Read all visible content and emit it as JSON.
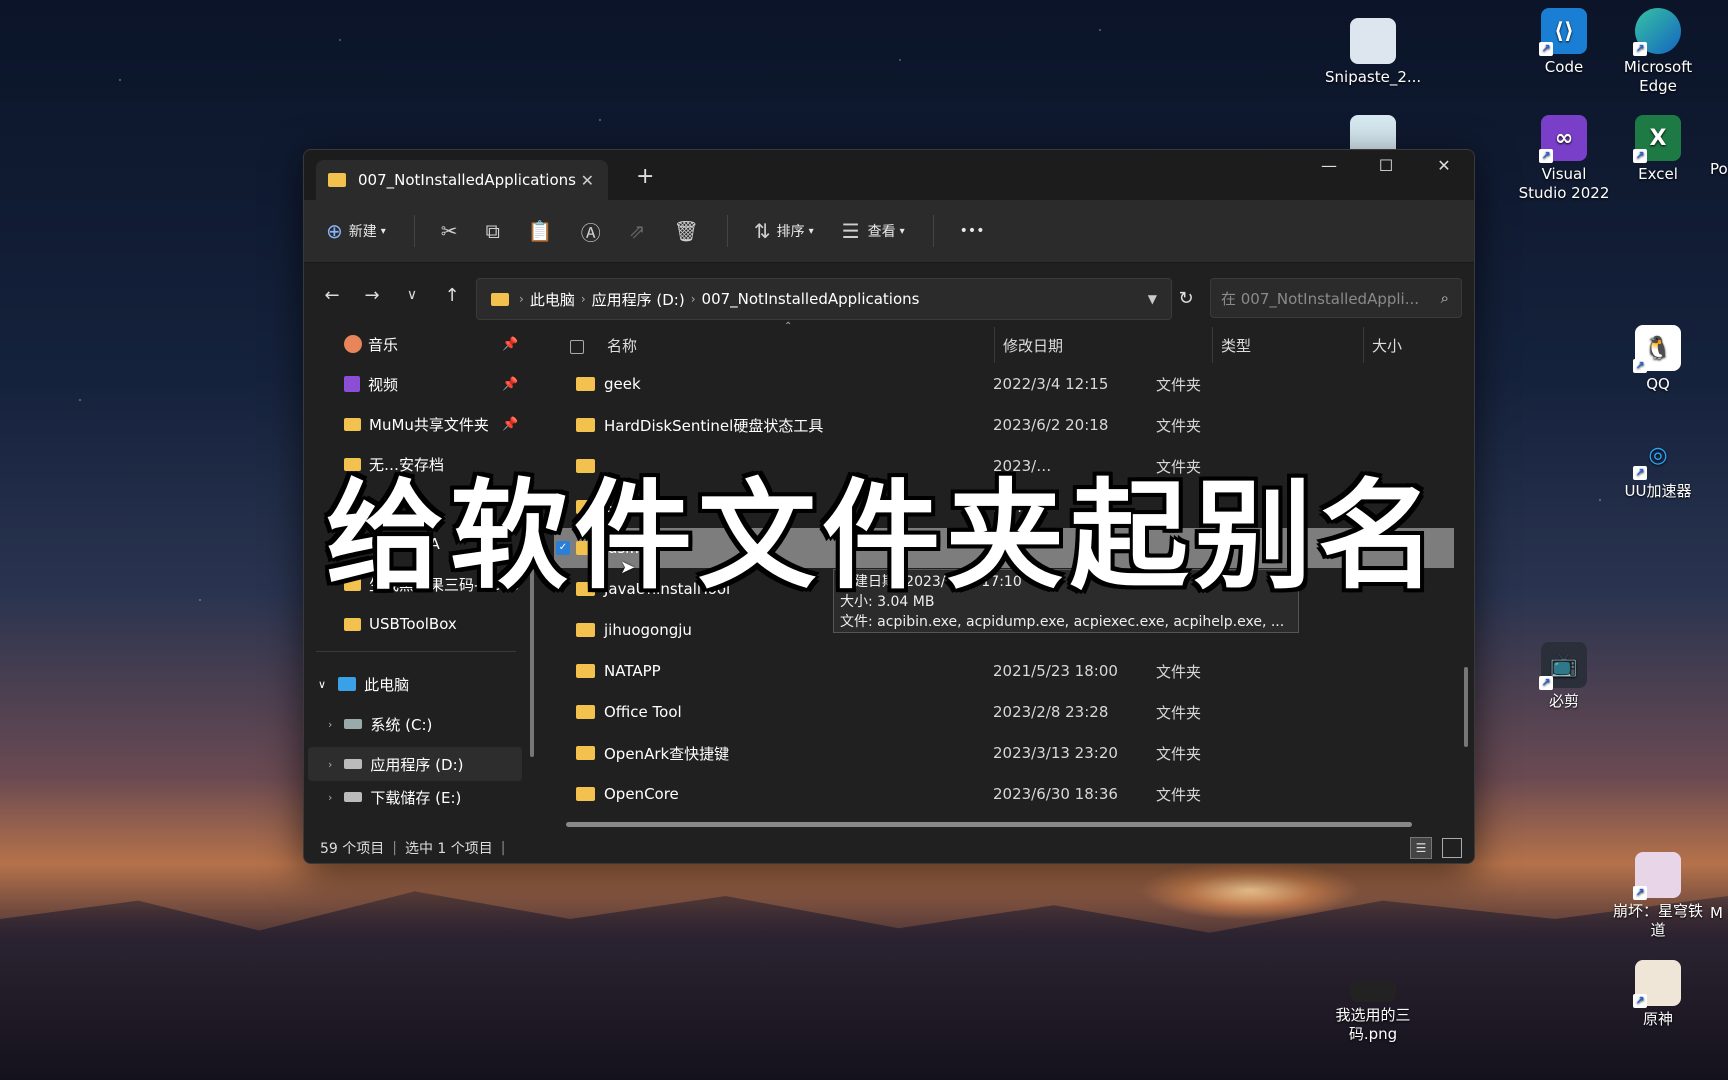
{
  "desktop": {
    "icons": [
      {
        "name": "snipaste-icon",
        "label": "Snipaste_2..."
      },
      {
        "name": "code-icon",
        "label": "Code"
      },
      {
        "name": "edge-icon",
        "label": "Microsoft Edge"
      },
      {
        "name": "vs2022-icon",
        "label": "Visual Studio 2022"
      },
      {
        "name": "excel-icon",
        "label": "Excel"
      },
      {
        "name": "qq-icon",
        "label": "QQ"
      },
      {
        "name": "uu-icon",
        "label": "UU加速器"
      },
      {
        "name": "bijian-icon",
        "label": "必剪"
      },
      {
        "name": "starrail-icon",
        "label": "崩坏：星穹铁道"
      },
      {
        "name": "yuanshen-icon",
        "label": "原神"
      },
      {
        "name": "png-file-icon",
        "label": "我选用的三码.png"
      }
    ],
    "edge_label_right": "Po",
    "edge_label_right2": "M"
  },
  "window": {
    "tab_title": "007_NotInstalledApplications",
    "toolbar": {
      "new_label": "新建",
      "sort_label": "排序",
      "view_label": "查看",
      "more": "•••"
    },
    "breadcrumb": [
      "此电脑",
      "应用程序 (D:)",
      "007_NotInstalledApplications"
    ],
    "search_placeholder": "在 007_NotInstalledAppli...",
    "sidebar": {
      "quick": [
        "音乐",
        "视频",
        "MuMu共享文件夹",
        "无…安存档",
        "…ta",
        "…nstall A",
        "生成黑苹果三码-GenS",
        "USBToolBox"
      ],
      "this_pc": "此电脑",
      "drives": [
        "系统 (C:)",
        "应用程序 (D:)",
        "下载储存 (E:)"
      ]
    },
    "columns": {
      "name": "名称",
      "date": "修改日期",
      "type": "类型",
      "size": "大小"
    },
    "rows": [
      {
        "name": "geek",
        "date": "2022/3/4 12:15",
        "type": "文件夹"
      },
      {
        "name": "HardDiskSentinel硬盘状态工具",
        "date": "2023/6/2 20:18",
        "type": "文件夹"
      },
      {
        "name": "",
        "date": "2023/…",
        "type": "文件夹"
      },
      {
        "name": "Sl…iacha",
        "date": "20…",
        "type": ""
      },
      {
        "name": "iasl…dt",
        "date": "",
        "type": ""
      },
      {
        "name": "JavaUninstallTool",
        "date": "",
        "type": ""
      },
      {
        "name": "jihuogongju",
        "date": "2023/…",
        "type": "文件夹"
      },
      {
        "name": "NATAPP",
        "date": "2021/5/23 18:00",
        "type": "文件夹"
      },
      {
        "name": "Office Tool",
        "date": "2023/2/8 23:28",
        "type": "文件夹"
      },
      {
        "name": "OpenArk查快捷键",
        "date": "2023/3/13 23:20",
        "type": "文件夹"
      },
      {
        "name": "OpenCore",
        "date": "2023/6/30 18:36",
        "type": "文件夹"
      }
    ],
    "tooltip": {
      "line1": "创建日期: 2023/6/29 17:10",
      "line2": "大小: 3.04 MB",
      "line3": "文件: acpibin.exe, acpidump.exe, acpiexec.exe, acpihelp.exe, ..."
    },
    "status": {
      "count": "59 个项目",
      "selected": "选中 1 个项目"
    }
  },
  "overlay_caption": "给软件文件夹起别名"
}
